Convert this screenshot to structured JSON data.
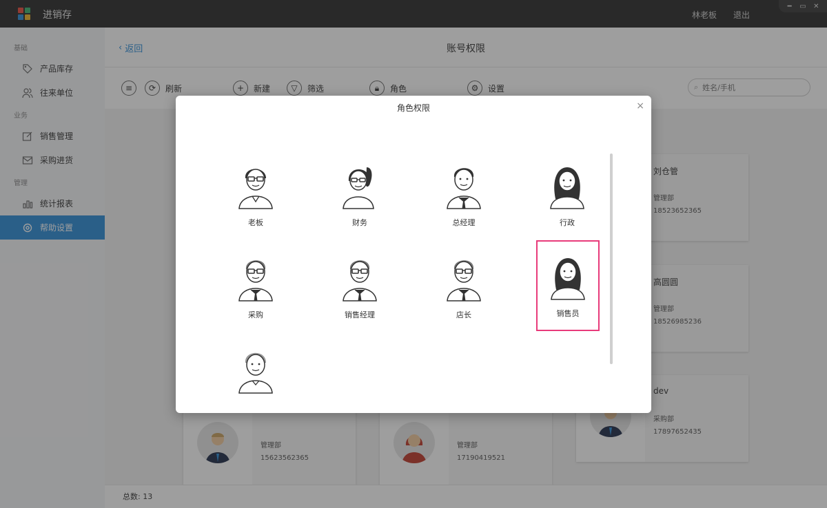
{
  "window": {
    "app_title": "进销存",
    "user_name": "林老板",
    "logout_label": "退出"
  },
  "sidebar": {
    "sections": [
      {
        "title": "基础",
        "items": [
          {
            "label": "产品库存",
            "icon": "tag-icon"
          },
          {
            "label": "往来单位",
            "icon": "users-icon"
          }
        ]
      },
      {
        "title": "业务",
        "items": [
          {
            "label": "销售管理",
            "icon": "edit-icon"
          },
          {
            "label": "采购进货",
            "icon": "inbox-icon"
          }
        ]
      },
      {
        "title": "管理",
        "items": [
          {
            "label": "统计报表",
            "icon": "bar-chart-icon"
          },
          {
            "label": "帮助设置",
            "icon": "gear-icon",
            "active": true
          }
        ]
      }
    ]
  },
  "header": {
    "back_label": "返回",
    "title": "账号权限"
  },
  "toolbar": {
    "menu_icon": "menu-icon",
    "refresh_label": "刷新",
    "new_label": "新建",
    "filter_label": "筛选",
    "role_label": "角色",
    "settings_label": "设置",
    "search_placeholder": "姓名/手机"
  },
  "cards": [
    {
      "name": "刘仓管",
      "dept": "管理部",
      "phone": "18523652365"
    },
    {
      "name": "高圆圆",
      "dept": "管理部",
      "phone": "18526985236"
    },
    {
      "name": "dev",
      "dept": "采购部",
      "phone": "17897652435"
    },
    {
      "name": "",
      "dept": "管理部",
      "phone": "15623562365"
    },
    {
      "name": "",
      "dept": "管理部",
      "phone": "17190419521"
    }
  ],
  "status": {
    "total_label": "总数:",
    "total_value": "13"
  },
  "modal": {
    "title": "角色权限",
    "close": "×",
    "roles": [
      {
        "label": "老板",
        "avatar": "man-glasses-avatar"
      },
      {
        "label": "财务",
        "avatar": "woman-ponytail-avatar"
      },
      {
        "label": "总经理",
        "avatar": "man-tie-avatar"
      },
      {
        "label": "行政",
        "avatar": "woman-long-hair-avatar"
      },
      {
        "label": "采购",
        "avatar": "man-glasses-tie-avatar"
      },
      {
        "label": "销售经理",
        "avatar": "man-glasses-tie-avatar"
      },
      {
        "label": "店长",
        "avatar": "man-glasses-tie-avatar"
      },
      {
        "label": "销售员",
        "avatar": "woman-long-hair-avatar",
        "selected": true
      },
      {
        "label": "",
        "avatar": "man-gray-hair-avatar"
      }
    ]
  },
  "colors": {
    "accent": "#2d8cd8",
    "selected_border": "#e83a7a",
    "titlebar": "#2b2b2b"
  }
}
